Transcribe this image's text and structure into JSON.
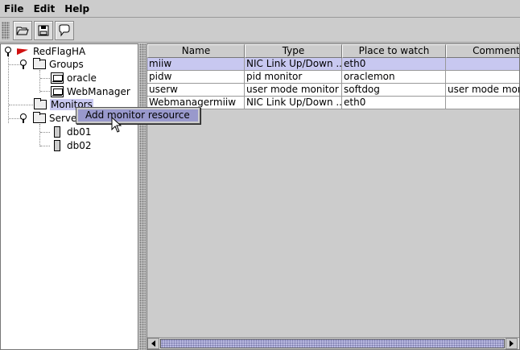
{
  "menubar": {
    "file": "File",
    "edit": "Edit",
    "help": "Help"
  },
  "toolbar": {
    "buttons": [
      "open-folder-icon",
      "save-disk-icon",
      "speech-bubble-icon"
    ]
  },
  "tree": {
    "root": "RedFlagHA",
    "groups": "Groups",
    "group_items": [
      "oracle",
      "WebManager"
    ],
    "monitors": "Monitors",
    "servers": "Servers",
    "server_items": [
      "db01",
      "db02"
    ]
  },
  "table": {
    "columns": [
      "Name",
      "Type",
      "Place to watch",
      "Comment"
    ],
    "rows": [
      [
        "miiw",
        "NIC Link Up/Down ...",
        "eth0",
        ""
      ],
      [
        "pidw",
        "pid monitor",
        "oraclemon",
        ""
      ],
      [
        "userw",
        "user mode monitor",
        "softdog",
        "user mode moni"
      ],
      [
        "Webmanagermiiw",
        "NIC Link Up/Down ...",
        "eth0",
        ""
      ]
    ]
  },
  "context_menu": {
    "item": "Add monitor resource"
  },
  "colors": {
    "selection": "#c8c8f0",
    "menu_highlight": "#9999cc",
    "flag": "#d01010"
  }
}
